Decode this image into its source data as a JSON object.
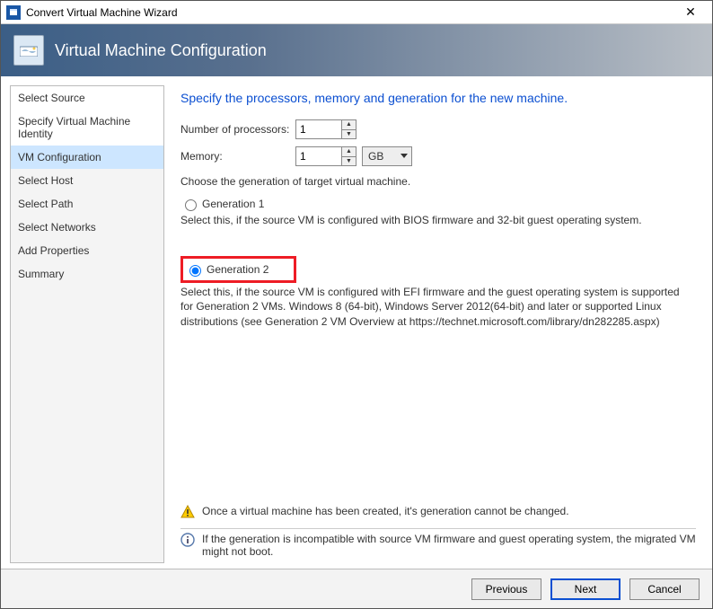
{
  "window": {
    "title": "Convert Virtual Machine Wizard"
  },
  "banner": {
    "title": "Virtual Machine Configuration"
  },
  "sidebar": {
    "items": [
      {
        "label": "Select Source",
        "state": "done"
      },
      {
        "label": "Specify Virtual Machine Identity",
        "state": "done"
      },
      {
        "label": "VM Configuration",
        "state": "active"
      },
      {
        "label": "Select Host",
        "state": "pending"
      },
      {
        "label": "Select Path",
        "state": "pending"
      },
      {
        "label": "Select Networks",
        "state": "pending"
      },
      {
        "label": "Add Properties",
        "state": "pending"
      },
      {
        "label": "Summary",
        "state": "pending"
      }
    ]
  },
  "form": {
    "heading": "Specify the processors, memory and generation for the new machine.",
    "processors_label": "Number of processors:",
    "processors_value": "1",
    "memory_label": "Memory:",
    "memory_value": "1",
    "memory_unit": "GB",
    "gen_intro": "Choose the generation of target virtual machine.",
    "gen1_label": "Generation 1",
    "gen1_desc": "Select this, if the source VM is configured with BIOS firmware and 32-bit guest operating system.",
    "gen2_label": "Generation 2",
    "gen2_desc": "Select this, if the source VM is configured with EFI firmware and the guest operating system is supported for Generation 2 VMs. Windows 8 (64-bit), Windows Server 2012(64-bit) and later or supported Linux distributions (see Generation 2 VM Overview at https://technet.microsoft.com/library/dn282285.aspx)",
    "selected_generation": "gen2",
    "warning": "Once a virtual machine has been created, it's generation cannot be changed.",
    "info": "If the generation is incompatible with source VM firmware and guest operating system, the migrated VM might not boot."
  },
  "footer": {
    "previous": "Previous",
    "next": "Next",
    "cancel": "Cancel"
  }
}
